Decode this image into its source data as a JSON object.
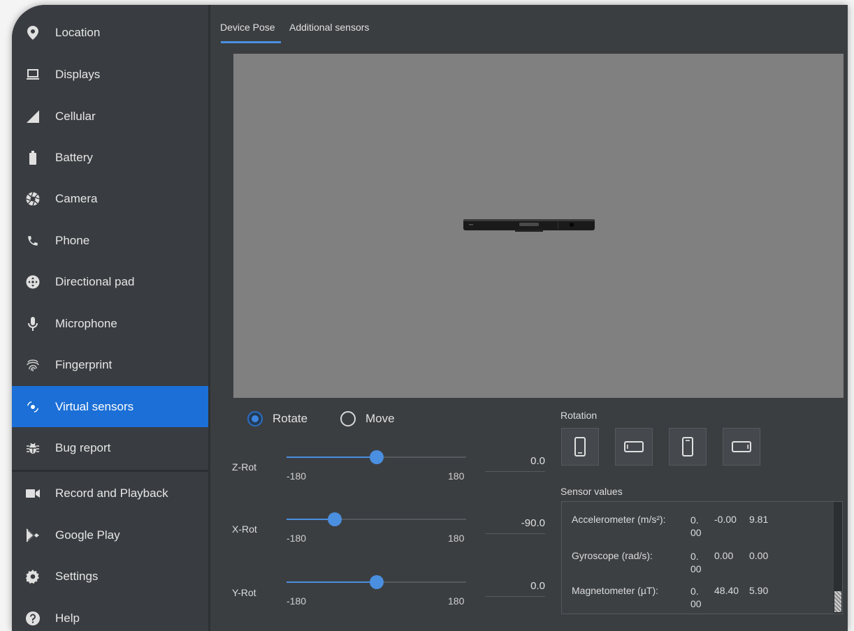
{
  "sidebar": {
    "items": [
      {
        "label": "Location",
        "icon": "location-pin-icon"
      },
      {
        "label": "Displays",
        "icon": "display-icon"
      },
      {
        "label": "Cellular",
        "icon": "cellular-signal-icon"
      },
      {
        "label": "Battery",
        "icon": "battery-icon"
      },
      {
        "label": "Camera",
        "icon": "camera-aperture-icon"
      },
      {
        "label": "Phone",
        "icon": "phone-handset-icon"
      },
      {
        "label": "Directional pad",
        "icon": "dpad-icon"
      },
      {
        "label": "Microphone",
        "icon": "microphone-icon"
      },
      {
        "label": "Fingerprint",
        "icon": "fingerprint-icon"
      },
      {
        "label": "Virtual sensors",
        "icon": "virtual-sensors-icon",
        "active": true
      },
      {
        "label": "Bug report",
        "icon": "bug-icon"
      },
      {
        "label": "Record and Playback",
        "icon": "video-camera-icon"
      },
      {
        "label": "Google Play",
        "icon": "google-play-icon"
      },
      {
        "label": "Settings",
        "icon": "gear-icon"
      },
      {
        "label": "Help",
        "icon": "help-icon"
      }
    ]
  },
  "tabs": [
    {
      "label": "Device Pose",
      "active": true
    },
    {
      "label": "Additional sensors",
      "active": false
    }
  ],
  "mode": {
    "rotate_label": "Rotate",
    "move_label": "Move",
    "selected": "Rotate"
  },
  "sliders": [
    {
      "label": "Z-Rot",
      "min_label": "-180",
      "max_label": "180",
      "value": "0.0",
      "fraction": 0.5
    },
    {
      "label": "X-Rot",
      "min_label": "-180",
      "max_label": "180",
      "value": "-90.0",
      "fraction": 0.27
    },
    {
      "label": "Y-Rot",
      "min_label": "-180",
      "max_label": "180",
      "value": "0.0",
      "fraction": 0.5
    }
  ],
  "rotation": {
    "label": "Rotation",
    "buttons": [
      "portrait-icon",
      "landscape-icon",
      "reverse-portrait-icon",
      "reverse-landscape-icon"
    ]
  },
  "sensor_values": {
    "label": "Sensor values",
    "rows": [
      {
        "name": "Accelerometer (m/s²):",
        "v1a": "0.",
        "v1b": "00",
        "v2": "-0.00",
        "v3": "9.81"
      },
      {
        "name": "Gyroscope (rad/s):",
        "v1a": "0.",
        "v1b": "00",
        "v2": "0.00",
        "v3": "0.00"
      },
      {
        "name": "Magnetometer (µT):",
        "v1a": "0.",
        "v1b": "00",
        "v2": "48.40",
        "v3": "5.90"
      }
    ]
  },
  "colors": {
    "accent": "#1b6fd6",
    "slider": "#4a8fe0",
    "panel_bg": "#3b3e41",
    "viewport_bg": "#808080"
  }
}
